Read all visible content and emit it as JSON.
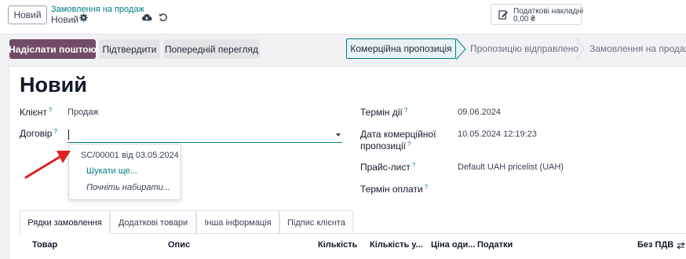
{
  "topbar": {
    "new_button": "Новий",
    "breadcrumb_parent": "Замовлення на продаж",
    "breadcrumb_current": "Новий",
    "invoice_label": "Податкові накладні",
    "invoice_value": "0,00 ₴"
  },
  "actions": {
    "send_email": "Надіслати поштою",
    "confirm": "Підтвердити",
    "preview": "Попередній перегляд"
  },
  "statusbar": {
    "stages": [
      "Комерційна пропозиція",
      "Пропозицію відправлено",
      "Замовлення на продаж"
    ],
    "active": "Комерційна пропозиція"
  },
  "form": {
    "title": "Новий",
    "client_label": "Клієнт",
    "client_value": "Продаж",
    "contract_label": "Договір",
    "contract_value": "",
    "validity_label": "Термін дії",
    "validity_value": "09.06.2024",
    "quote_date_label_1": "Дата комерційної",
    "quote_date_label_2": "пропозиції",
    "quote_date_value": "10.05.2024 12:19:23",
    "pricelist_label": "Прайс-лист",
    "pricelist_value": "Default UAH pricelist (UAH)",
    "payment_terms_label": "Термін оплати",
    "help_mark": "?"
  },
  "dropdown": {
    "items": [
      "SC/00001 від 03.05.2024",
      "Шукати ще...",
      "Почніть набирати..."
    ]
  },
  "tabs": [
    "Рядки замовлення",
    "Додаткові товари",
    "Інша інформація",
    "Підпис клієнта"
  ],
  "table": {
    "headers": [
      "Товар",
      "Опис",
      "Кількість",
      "Кількість у...",
      "Ціна оди...",
      "Податки",
      "Без ПДВ"
    ]
  },
  "colors": {
    "brand": "#714b67",
    "accent": "#017e84",
    "arrow": "#e02020"
  }
}
